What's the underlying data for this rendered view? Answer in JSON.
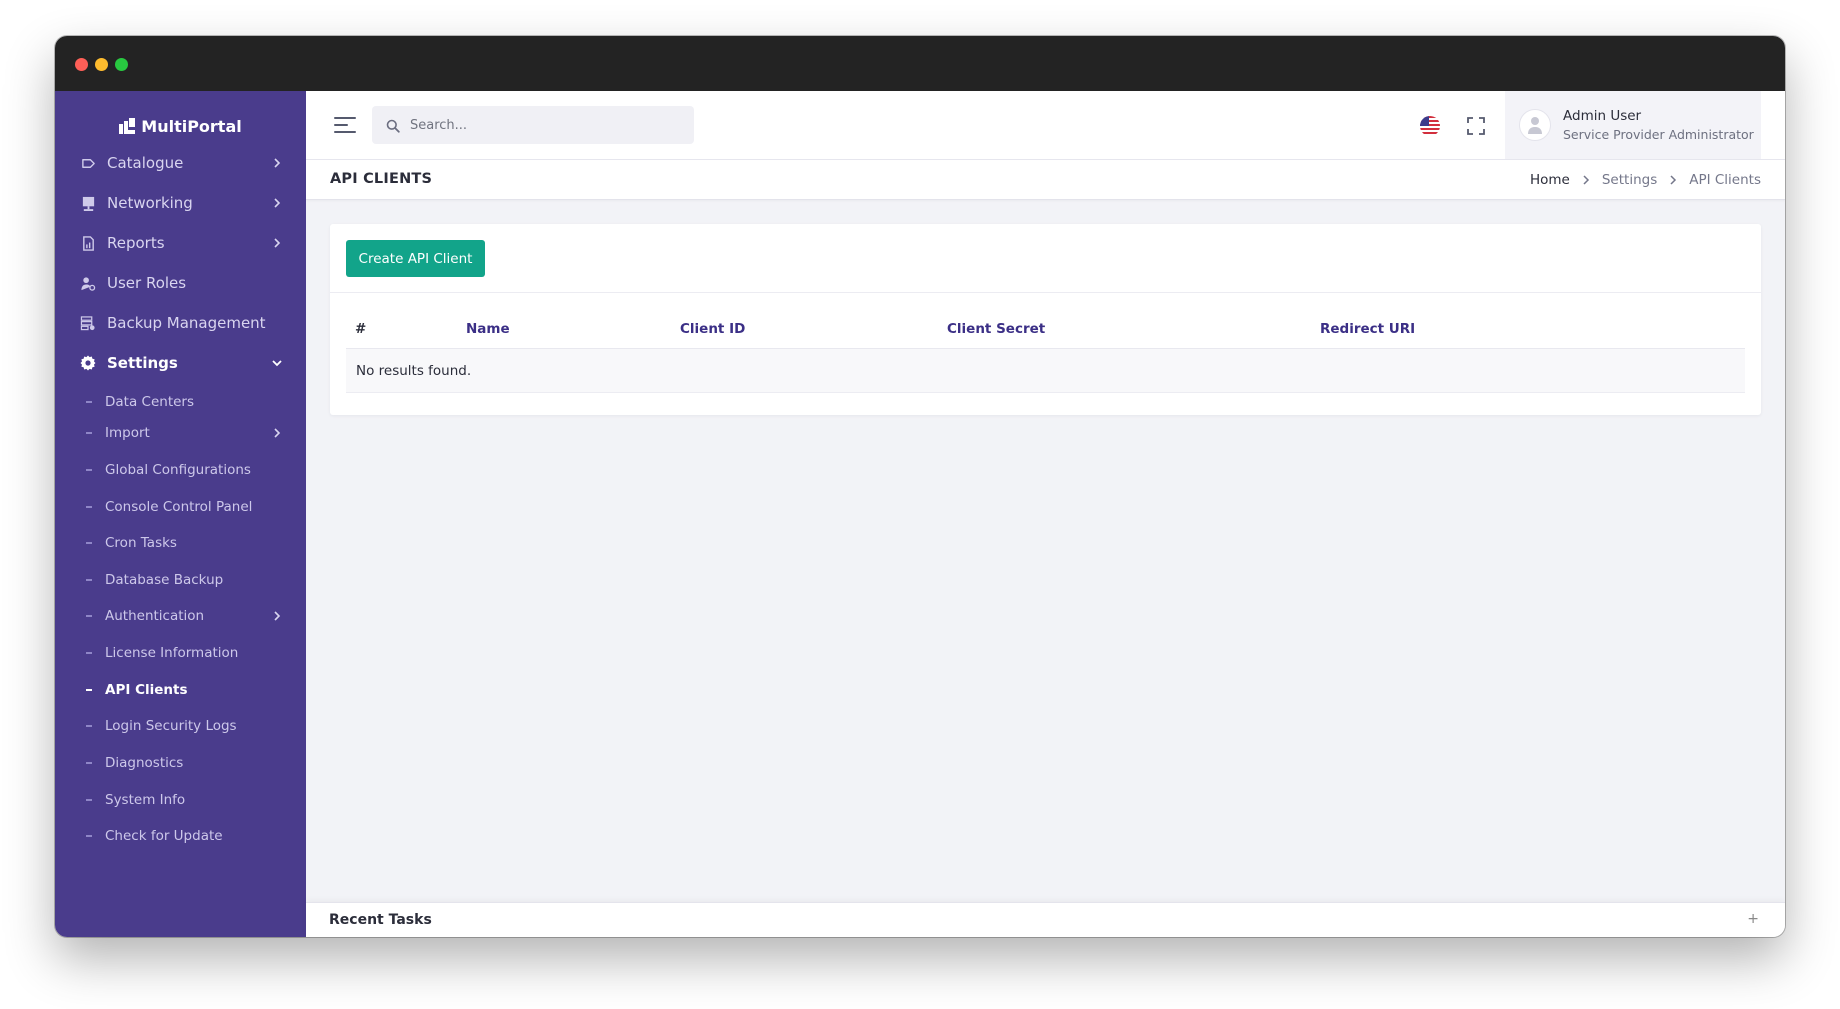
{
  "app": {
    "brand": "MultiPortal"
  },
  "sidebar": {
    "items": [
      {
        "label": "Catalogue",
        "icon": "tag-icon",
        "chevron": "right"
      },
      {
        "label": "Networking",
        "icon": "network-icon",
        "chevron": "right"
      },
      {
        "label": "Reports",
        "icon": "report-icon",
        "chevron": "right"
      },
      {
        "label": "User Roles",
        "icon": "user-roles-icon",
        "chevron": ""
      },
      {
        "label": "Backup Management",
        "icon": "backup-icon",
        "chevron": ""
      },
      {
        "label": "Settings",
        "icon": "gear-icon",
        "chevron": "down"
      }
    ],
    "subitems": [
      {
        "label": "Data Centers"
      },
      {
        "label": "Import",
        "chevron": "right"
      },
      {
        "label": "Global Configurations"
      },
      {
        "label": "Console Control Panel"
      },
      {
        "label": "Cron Tasks"
      },
      {
        "label": "Database Backup"
      },
      {
        "label": "Authentication",
        "chevron": "right"
      },
      {
        "label": "License Information"
      },
      {
        "label": "API Clients",
        "active": true
      },
      {
        "label": "Login Security Logs"
      },
      {
        "label": "Diagnostics"
      },
      {
        "label": "System Info"
      },
      {
        "label": "Check for Update"
      }
    ]
  },
  "header": {
    "search_placeholder": "Search...",
    "icons": [
      "us-flag-icon",
      "fullscreen-icon",
      "moon-icon"
    ],
    "user": {
      "name": "Admin User",
      "role": "Service Provider Administrator"
    }
  },
  "page": {
    "title": "API CLIENTS",
    "breadcrumb": [
      "Home",
      "Settings",
      "API Clients"
    ]
  },
  "card": {
    "create_button": "Create API Client",
    "columns": [
      "#",
      "Name",
      "Client ID",
      "Client Secret",
      "Redirect URI"
    ],
    "empty_text": "No results found."
  },
  "footer": {
    "recent_tasks": "Recent Tasks",
    "toggle": "+"
  },
  "colors": {
    "sidebar": "#4a3c8c",
    "accent_button": "#12a48a",
    "table_header": "#3b2f86"
  }
}
